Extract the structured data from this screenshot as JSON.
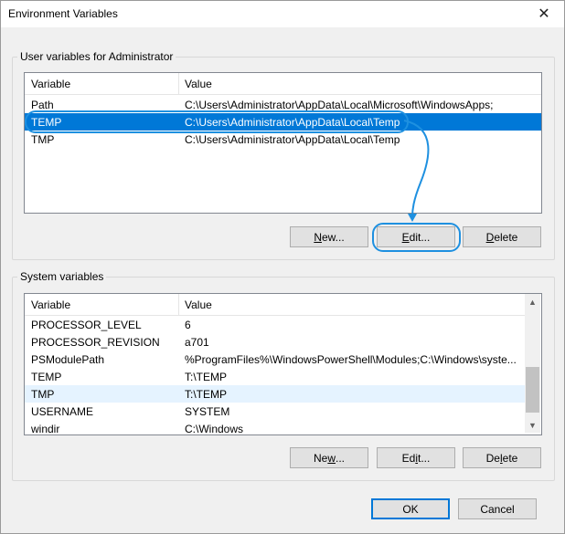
{
  "window": {
    "title": "Environment Variables",
    "close_glyph": "✕"
  },
  "user_vars": {
    "group_label": "User variables for Administrator",
    "columns": [
      "Variable",
      "Value"
    ],
    "rows": [
      {
        "variable": "Path",
        "value": "C:\\Users\\Administrator\\AppData\\Local\\Microsoft\\WindowsApps;"
      },
      {
        "variable": "TEMP",
        "value": "C:\\Users\\Administrator\\AppData\\Local\\Temp"
      },
      {
        "variable": "TMP",
        "value": "C:\\Users\\Administrator\\AppData\\Local\\Temp"
      }
    ],
    "selected_row": 1,
    "buttons": {
      "new": {
        "pre": "",
        "u": "N",
        "post": "ew..."
      },
      "edit": {
        "pre": "",
        "u": "E",
        "post": "dit..."
      },
      "delete": {
        "pre": "",
        "u": "D",
        "post": "elete"
      }
    }
  },
  "system_vars": {
    "group_label": "System variables",
    "columns": [
      "Variable",
      "Value"
    ],
    "rows": [
      {
        "variable": "PROCESSOR_LEVEL",
        "value": "6"
      },
      {
        "variable": "PROCESSOR_REVISION",
        "value": "a701"
      },
      {
        "variable": "PSModulePath",
        "value": "%ProgramFiles%\\WindowsPowerShell\\Modules;C:\\Windows\\syste..."
      },
      {
        "variable": "TEMP",
        "value": "T:\\TEMP"
      },
      {
        "variable": "TMP",
        "value": "T:\\TEMP"
      },
      {
        "variable": "USERNAME",
        "value": "SYSTEM"
      },
      {
        "variable": "windir",
        "value": "C:\\Windows"
      }
    ],
    "hover_row": 4,
    "buttons": {
      "new": {
        "pre": "Ne",
        "u": "w",
        "post": "..."
      },
      "edit": {
        "pre": "Ed",
        "u": "i",
        "post": "t..."
      },
      "delete": {
        "pre": "De",
        "u": "l",
        "post": "ete"
      }
    }
  },
  "footer": {
    "ok": "OK",
    "cancel": "Cancel"
  },
  "colors": {
    "selection": "#0078d7",
    "annotation": "#1e90e0",
    "hover": "#e5f3ff"
  }
}
